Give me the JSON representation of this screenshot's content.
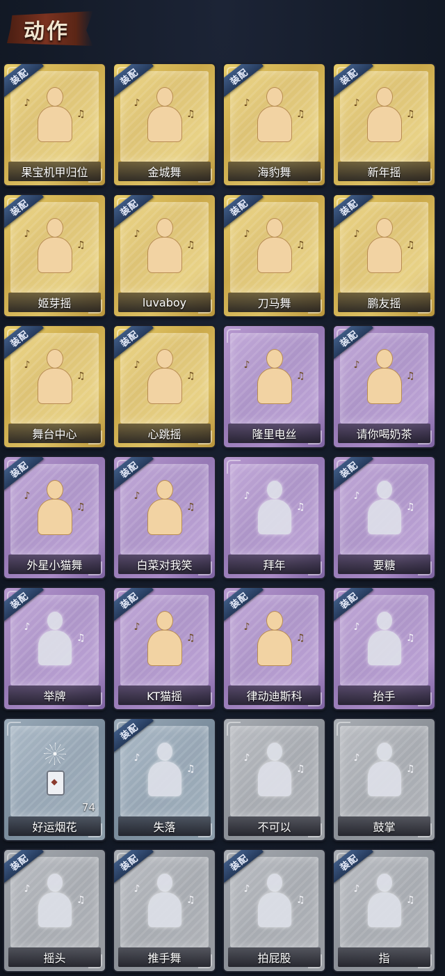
{
  "header": {
    "title": "动作"
  },
  "badge_text": "装配",
  "cards": [
    {
      "label": "果宝机甲归位",
      "tier": "gold",
      "equipped": true,
      "figure": "warm",
      "icon": "dance-figure-icon"
    },
    {
      "label": "金城舞",
      "tier": "gold",
      "equipped": true,
      "figure": "warm",
      "icon": "dance-figure-icon"
    },
    {
      "label": "海豹舞",
      "tier": "gold",
      "equipped": true,
      "figure": "warm",
      "icon": "dance-figure-icon"
    },
    {
      "label": "新年摇",
      "tier": "gold",
      "equipped": true,
      "figure": "warm",
      "icon": "dance-figure-icon"
    },
    {
      "label": "姬芽摇",
      "tier": "gold",
      "equipped": true,
      "figure": "warm",
      "icon": "dance-figure-icon"
    },
    {
      "label": "luvaboy",
      "tier": "gold",
      "equipped": true,
      "figure": "warm",
      "icon": "dance-figure-icon"
    },
    {
      "label": "刀马舞",
      "tier": "gold",
      "equipped": true,
      "figure": "warm",
      "icon": "dance-figure-icon"
    },
    {
      "label": "鹏友摇",
      "tier": "gold",
      "equipped": true,
      "figure": "warm",
      "icon": "dance-figure-icon"
    },
    {
      "label": "舞台中心",
      "tier": "gold",
      "equipped": true,
      "figure": "warm",
      "icon": "dance-figure-icon"
    },
    {
      "label": "心跳摇",
      "tier": "gold",
      "equipped": true,
      "figure": "warm",
      "icon": "dance-figure-icon"
    },
    {
      "label": "隆里电丝",
      "tier": "purple",
      "equipped": false,
      "figure": "warm",
      "icon": "dance-figure-icon"
    },
    {
      "label": "请你喝奶茶",
      "tier": "purple",
      "equipped": true,
      "figure": "warm",
      "icon": "sign-figure-icon"
    },
    {
      "label": "外星小猫舞",
      "tier": "purple",
      "equipped": true,
      "figure": "warm",
      "icon": "dance-figure-icon"
    },
    {
      "label": "白菜对我笑",
      "tier": "purple",
      "equipped": true,
      "figure": "warm",
      "icon": "dance-figure-icon"
    },
    {
      "label": "拜年",
      "tier": "purple",
      "equipped": false,
      "figure": "cool",
      "icon": "bow-figure-icon"
    },
    {
      "label": "要糖",
      "tier": "purple",
      "equipped": true,
      "figure": "cool",
      "icon": "reach-figure-icon"
    },
    {
      "label": "举牌",
      "tier": "purple",
      "equipped": true,
      "figure": "cool",
      "icon": "sign-figure-icon"
    },
    {
      "label": "KT猫摇",
      "tier": "purple",
      "equipped": true,
      "figure": "warm",
      "icon": "dance-figure-icon"
    },
    {
      "label": "律动迪斯科",
      "tier": "purple",
      "equipped": true,
      "figure": "warm",
      "icon": "disco-figure-icon"
    },
    {
      "label": "抬手",
      "tier": "purple",
      "equipped": true,
      "figure": "cool",
      "icon": "raise-hand-figure-icon"
    },
    {
      "label": "好运烟花",
      "tier": "blue",
      "equipped": false,
      "figure": "firework",
      "icon": "firework-icon",
      "count": "74"
    },
    {
      "label": "失落",
      "tier": "blue",
      "equipped": true,
      "figure": "cool",
      "icon": "crawl-figure-icon"
    },
    {
      "label": "不可以",
      "tier": "gray",
      "equipped": false,
      "figure": "cool",
      "icon": "finger-wag-icon"
    },
    {
      "label": "鼓掌",
      "tier": "gray",
      "equipped": false,
      "figure": "cool",
      "icon": "clap-icon"
    },
    {
      "label": "摇头",
      "tier": "gray",
      "equipped": true,
      "figure": "cool",
      "icon": "shake-head-figure-icon"
    },
    {
      "label": "推手舞",
      "tier": "gray",
      "equipped": true,
      "figure": "cool",
      "icon": "push-hand-figure-icon"
    },
    {
      "label": "拍屁股",
      "tier": "gray",
      "equipped": true,
      "figure": "cool",
      "icon": "slap-figure-icon"
    },
    {
      "label": "指",
      "tier": "gray",
      "equipped": true,
      "figure": "cool",
      "icon": "point-figure-icon"
    }
  ]
}
